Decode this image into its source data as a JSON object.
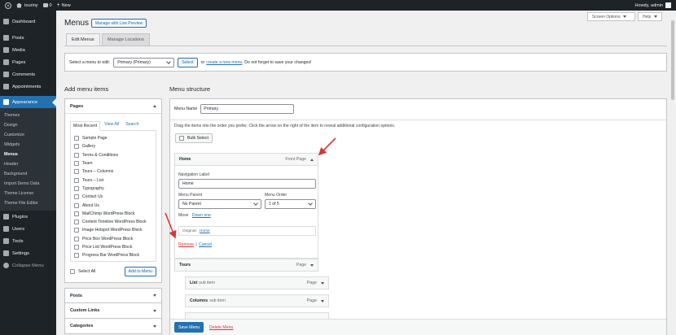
{
  "adminbar": {
    "site_name": "touriny",
    "comments_count": "0",
    "new_label": "New",
    "howdy": "Howdy, admin"
  },
  "sidebar": {
    "items": [
      {
        "label": "Dashboard",
        "icon": "dashboard-icon"
      },
      {
        "label": "Posts",
        "icon": "pin-icon"
      },
      {
        "label": "Media",
        "icon": "media-icon"
      },
      {
        "label": "Pages",
        "icon": "pages-icon"
      },
      {
        "label": "Comments",
        "icon": "comment-icon"
      },
      {
        "label": "Appointments",
        "icon": "calendar-icon"
      },
      {
        "label": "Appearance",
        "icon": "brush-icon"
      }
    ],
    "appearance_sub": [
      "Themes",
      "Design",
      "Customize",
      "Widgets",
      "Menus",
      "Header",
      "Background",
      "Import Demo Data",
      "Theme License",
      "Theme File Editor"
    ],
    "bottom_items": [
      {
        "label": "Plugins",
        "icon": "plugin-icon"
      },
      {
        "label": "Users",
        "icon": "users-icon"
      },
      {
        "label": "Tools",
        "icon": "tools-icon"
      },
      {
        "label": "Settings",
        "icon": "settings-icon"
      }
    ],
    "collapse_label": "Collapse Menu"
  },
  "header": {
    "screen_options": "Screen Options",
    "help": "Help",
    "title": "Menus",
    "live_preview": "Manage with Live Preview"
  },
  "tabs": [
    {
      "label": "Edit Menus"
    },
    {
      "label": "Manage Locations"
    }
  ],
  "select_bar": {
    "label": "Select a menu to edit:",
    "selected": "Primary (Primary)",
    "select_btn": "Select",
    "or": "or",
    "create_link": "create a new menu",
    "tail": ". Do not forget to save your changes!"
  },
  "add_items": {
    "heading": "Add menu items",
    "pages_title": "Pages",
    "sub_tabs": [
      "Most Recent",
      "View All",
      "Search"
    ],
    "pages": [
      "Sample Page",
      "Gallery",
      "Terms & Conditions",
      "Team",
      "Tours – Columns",
      "Tours – List",
      "Typography",
      "Contact Us",
      "About Us",
      "MailChimp WordPress Block",
      "Content Timeline WordPress Block",
      "Image Hotspot WordPress Block",
      "Price Box WordPress Block",
      "Price List WordPress Block",
      "Progress Bar WordPress Block"
    ],
    "select_all": "Select All",
    "add_to_menu": "Add to Menu",
    "other_panels": [
      "Posts",
      "Custom Links",
      "Categories"
    ]
  },
  "structure": {
    "heading": "Menu structure",
    "menu_name_label": "Menu Name",
    "menu_name_value": "Primary",
    "instructions": "Drag the items into the order you prefer. Click the arrow on the right of the item to reveal additional configuration options.",
    "bulk_select": "Bulk Select",
    "home": {
      "title": "Home",
      "type": "Front Page",
      "nav_label_label": "Navigation Label",
      "nav_label_value": "Home",
      "parent_label": "Menu Parent",
      "parent_value": "No Parent",
      "order_label": "Menu Order",
      "order_value": "1 of 5",
      "move_label": "Move",
      "move_link": "Down one",
      "original_label": "Original:",
      "original_link": "Home",
      "remove": "Remove",
      "sep": "|",
      "cancel": "Cancel"
    },
    "items": [
      {
        "title": "Tours",
        "sub": "",
        "type": "Page"
      },
      {
        "title": "List",
        "sub": "sub item",
        "type": "Page"
      },
      {
        "title": "Columns",
        "sub": "sub item",
        "type": "Page"
      }
    ],
    "save_menu": "Save Menu",
    "delete_menu": "Delete Menu"
  },
  "colors": {
    "accent": "#2271b1",
    "adminbar": "#1d2327",
    "annotation": "#d63638",
    "delete": "#d63638"
  }
}
